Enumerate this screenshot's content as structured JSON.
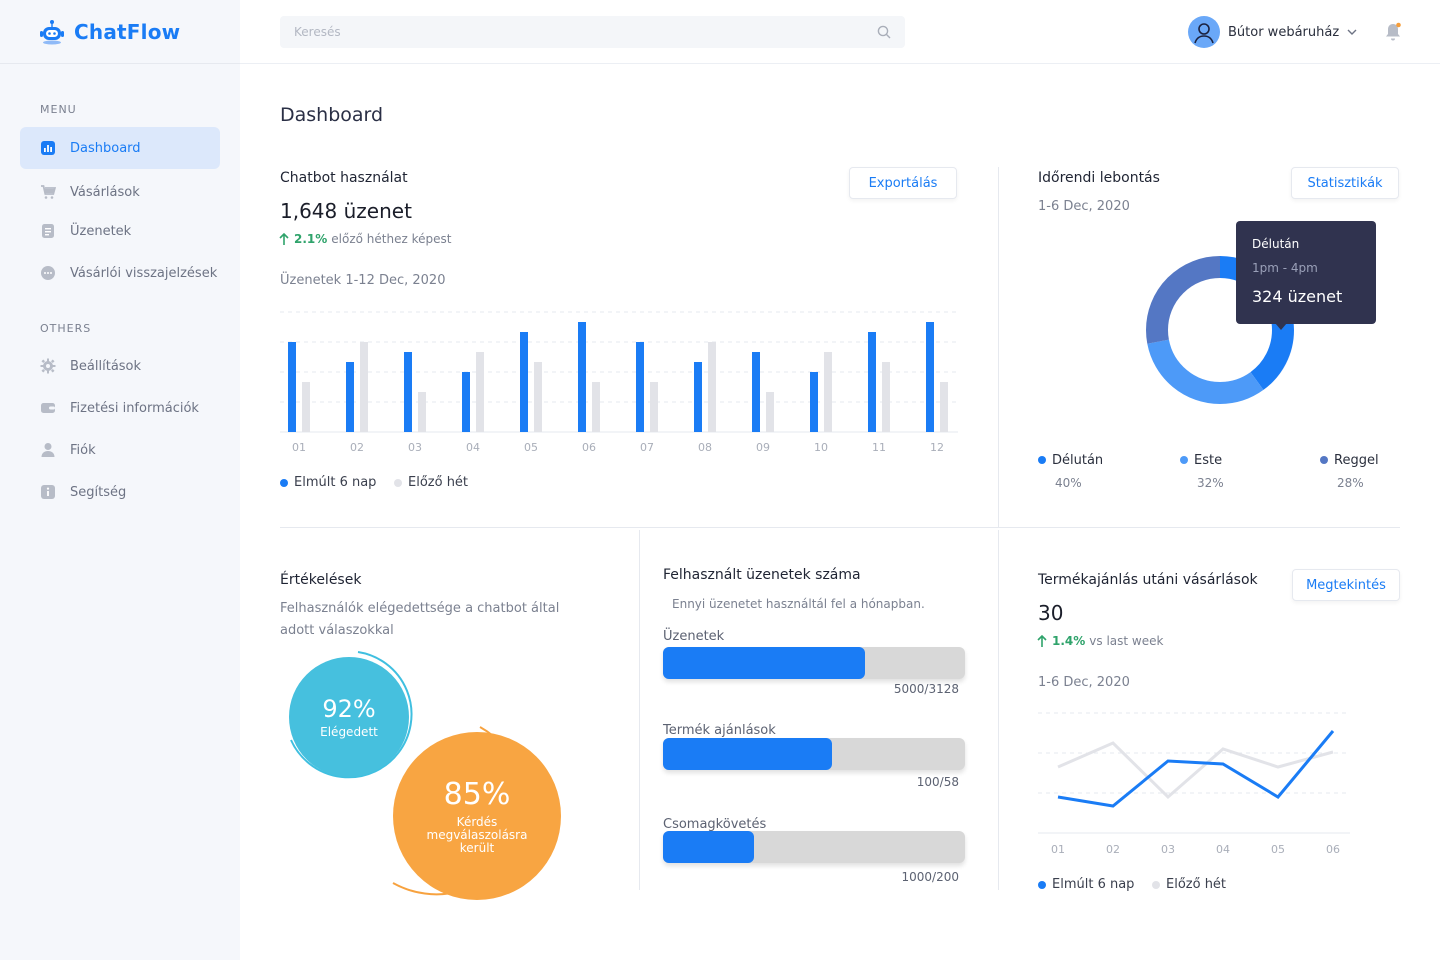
{
  "app": {
    "name": "ChatFlow"
  },
  "sidebar": {
    "menu_label": "MENU",
    "others_label": "OTHERS",
    "items": [
      {
        "label": "Dashboard",
        "icon": "bar-chart-icon"
      },
      {
        "label": "Vásárlások",
        "icon": "cart-icon"
      },
      {
        "label": "Üzenetek",
        "icon": "message-icon"
      },
      {
        "label": "Vásárlói visszajelzések",
        "icon": "chat-bubble-icon"
      }
    ],
    "others": [
      {
        "label": "Beállítások",
        "icon": "gear-icon"
      },
      {
        "label": "Fizetési információk",
        "icon": "wallet-icon"
      },
      {
        "label": "Fiók",
        "icon": "user-icon"
      },
      {
        "label": "Segítség",
        "icon": "info-icon"
      }
    ]
  },
  "header": {
    "search_placeholder": "Keresés",
    "user_name": "Bútor webáruház"
  },
  "page_title": "Dashboard",
  "usage": {
    "title": "Chatbot használat",
    "export_label": "Exportálás",
    "total": "1,648 üzenet",
    "trend_pct": "2.1%",
    "trend_text": "előző héthez képest",
    "range": "Üzenetek 1-12 Dec, 2020",
    "legend_current": "Elmúlt 6 nap",
    "legend_prev": "Előző hét"
  },
  "timeline": {
    "title": "Időrendi lebontás",
    "stats_label": "Statisztikák",
    "range": "1-6 Dec, 2020",
    "tooltip": {
      "title": "Délután",
      "time": "1pm - 4pm",
      "value": "324 üzenet"
    },
    "segments": [
      {
        "name": "Délután",
        "pct": "40%",
        "color": "#1a7cf5"
      },
      {
        "name": "Este",
        "pct": "32%",
        "color": "#4d9af8"
      },
      {
        "name": "Reggel",
        "pct": "28%",
        "color": "#5477c4"
      }
    ]
  },
  "ratings": {
    "title": "Értékelések",
    "desc_line1": "Felhasználók elégedettsége a chatbot által",
    "desc_line2": "adott válaszokkal",
    "satisfied_value": "92%",
    "satisfied_label": "Elégedett",
    "answered_value": "85%",
    "answered_label_1": "Kérdés",
    "answered_label_2": "megválaszolásra",
    "answered_label_3": "került"
  },
  "usage_count": {
    "title": "Felhasznált üzenetek száma",
    "desc": "Ennyi üzenetet használtál fel a hónapban.",
    "bars": [
      {
        "label": "Üzenetek",
        "value": "5000/3128",
        "fill": 0.67
      },
      {
        "label": "Termék ajánlások",
        "value": "100/58",
        "fill": 0.56
      },
      {
        "label": "Csomagkövetés",
        "value": "1000/200",
        "fill": 0.3
      }
    ]
  },
  "recommend": {
    "title": "Termékajánlás utáni vásárlások",
    "view_label": "Megtekintés",
    "total": "30",
    "trend_pct": "1.4%",
    "trend_text": "vs last week",
    "range": "1-6 Dec, 2020",
    "legend_current": "Elmúlt 6 nap",
    "legend_prev": "Előző hét"
  },
  "chart_data": [
    {
      "type": "bar",
      "categories": [
        "01",
        "02",
        "03",
        "04",
        "05",
        "06",
        "07",
        "08",
        "09",
        "10",
        "11",
        "12"
      ],
      "series": [
        {
          "name": "Elmúlt 6 nap",
          "color": "#1a7cf5",
          "values": [
            9,
            7,
            8,
            6,
            10,
            11,
            9,
            7,
            8,
            6,
            10,
            11
          ]
        },
        {
          "name": "Előző hét",
          "color": "#e2e3e8",
          "values": [
            5,
            9,
            4,
            8,
            7,
            5,
            5,
            9,
            4,
            8,
            7,
            5
          ]
        }
      ],
      "ylim": [
        0,
        12
      ]
    },
    {
      "type": "pie",
      "labels": [
        "Délután",
        "Este",
        "Reggel"
      ],
      "values": [
        40,
        32,
        28
      ]
    },
    {
      "type": "line",
      "categories": [
        "01",
        "02",
        "03",
        "04",
        "05",
        "06"
      ],
      "series": [
        {
          "name": "Elmúlt 6 nap",
          "color": "#1a7cf5",
          "values": [
            12,
            9,
            24,
            23,
            12,
            34
          ]
        },
        {
          "name": "Előző hét",
          "color": "#e2e3e8",
          "values": [
            22,
            30,
            12,
            28,
            22,
            27
          ]
        }
      ],
      "ylim": [
        0,
        40
      ]
    }
  ]
}
